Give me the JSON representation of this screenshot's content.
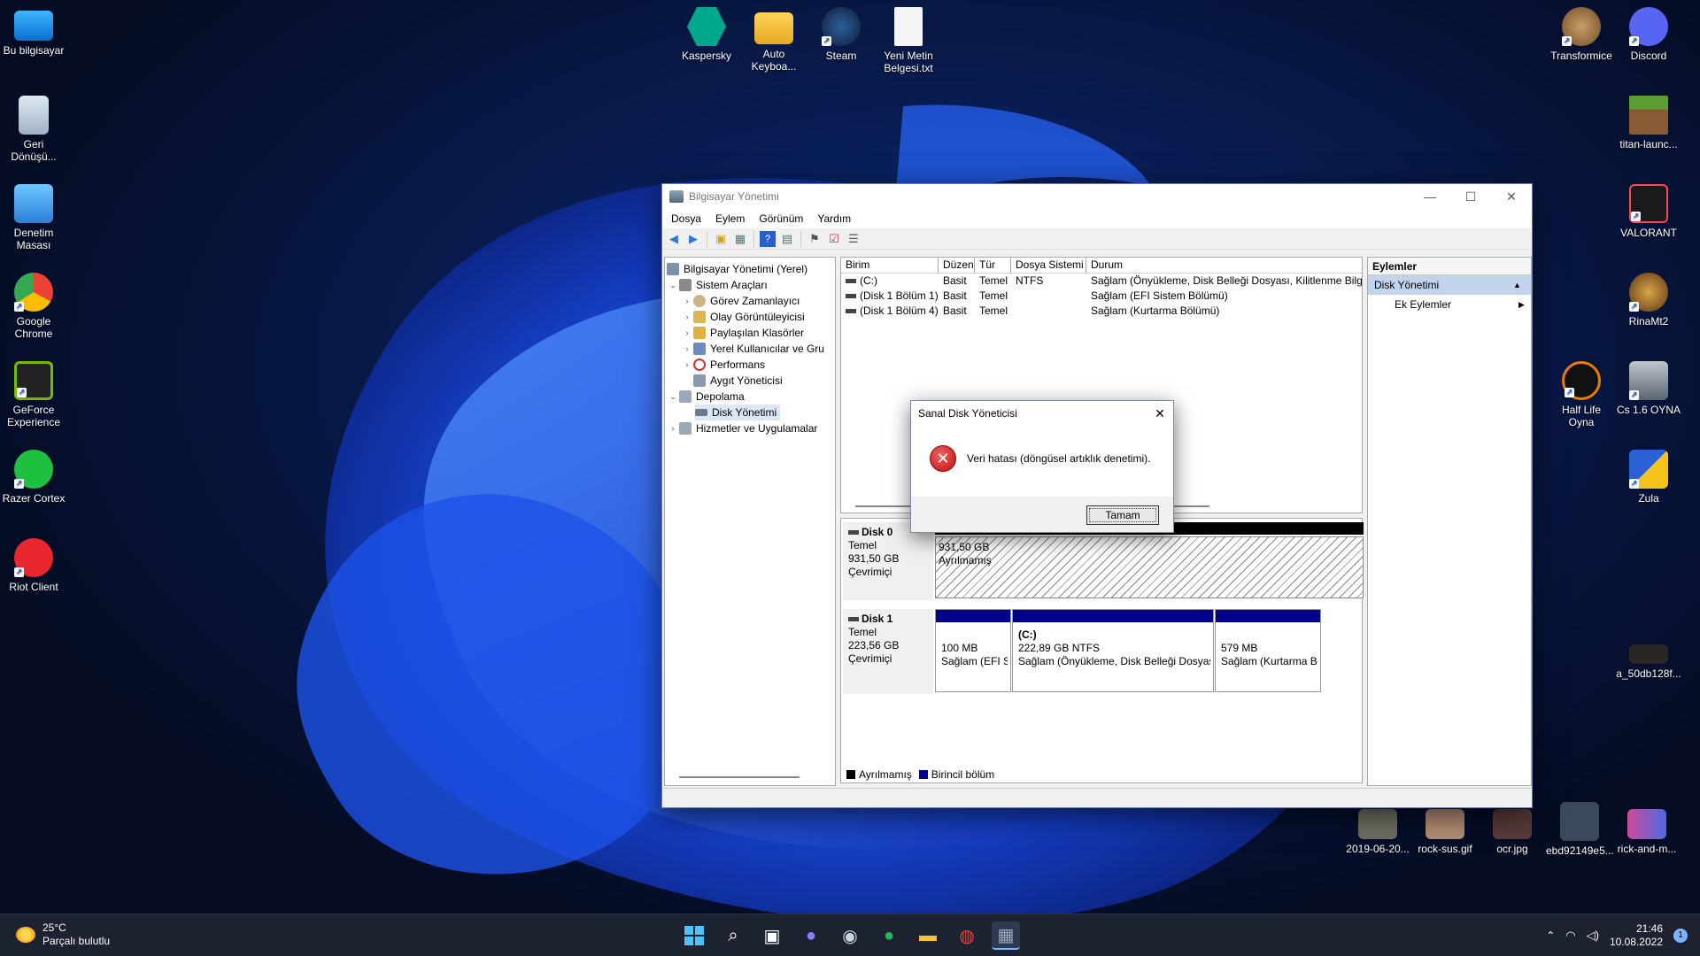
{
  "desktop": {
    "left_icons": [
      {
        "label": "Bu bilgisayar",
        "icon": "computer-icon"
      },
      {
        "label": "Geri Dönüşü...",
        "icon": "recycle-bin-icon"
      },
      {
        "label": "Denetim Masası",
        "icon": "control-panel-icon"
      },
      {
        "label": "Google Chrome",
        "icon": "chrome-icon"
      },
      {
        "label": "GeForce Experience",
        "icon": "geforce-icon"
      },
      {
        "label": "Razer Cortex",
        "icon": "razer-icon"
      },
      {
        "label": "Riot Client",
        "icon": "riot-icon"
      }
    ],
    "top_icons": [
      {
        "label": "Kaspersky",
        "icon": "kaspersky-icon"
      },
      {
        "label": "Auto Keyboa...",
        "icon": "folder-icon"
      },
      {
        "label": "Steam",
        "icon": "steam-icon"
      },
      {
        "label": "Yeni Metin Belgesi.txt",
        "icon": "text-file-icon"
      }
    ],
    "right_icons": [
      {
        "label": "Transformice",
        "icon": "transformice-icon"
      },
      {
        "label": "Discord",
        "icon": "discord-icon"
      },
      {
        "label": "titan-launc...",
        "icon": "minecraft-icon"
      },
      {
        "label": "VALORANT",
        "icon": "valorant-icon"
      },
      {
        "label": "RinaMt2",
        "icon": "rina-icon"
      },
      {
        "label": "Half Life Oyna",
        "icon": "half-life-icon"
      },
      {
        "label": "Cs 1.6 OYNA",
        "icon": "cs-icon"
      },
      {
        "label": "Zula",
        "icon": "zula-icon"
      },
      {
        "label": "a_50db128f...",
        "icon": "image-file-icon"
      }
    ],
    "bottom_icons": [
      {
        "label": "2019-06-20...",
        "icon": "image-file-icon"
      },
      {
        "label": "rock-sus.gif",
        "icon": "image-file-icon"
      },
      {
        "label": "ocr.jpg",
        "icon": "image-file-icon"
      },
      {
        "label": "ebd92149e5...",
        "icon": "image-file-icon"
      },
      {
        "label": "rick-and-m...",
        "icon": "image-file-icon"
      }
    ]
  },
  "window": {
    "title": "Bilgisayar Yönetimi",
    "menu": [
      "Dosya",
      "Eylem",
      "Görünüm",
      "Yardım"
    ],
    "tree": {
      "root": "Bilgisayar Yönetimi (Yerel)",
      "system_tools": "Sistem Araçları",
      "items": [
        "Görev Zamanlayıcı",
        "Olay Görüntüleyicisi",
        "Paylaşılan Klasörler",
        "Yerel Kullanıcılar ve Gru",
        "Performans",
        "Aygıt Yöneticisi"
      ],
      "storage": "Depolama",
      "disk_mgmt": "Disk Yönetimi",
      "services": "Hizmetler ve Uygulamalar"
    },
    "volumes": {
      "headers": [
        "Birim",
        "Düzen",
        "Tür",
        "Dosya Sistemi",
        "Durum"
      ],
      "rows": [
        [
          "(C:)",
          "Basit",
          "Temel",
          "NTFS",
          "Sağlam (Önyükleme, Disk Belleği Dosyası, Kilitlenme Bilgis"
        ],
        [
          "(Disk 1 Bölüm 1)",
          "Basit",
          "Temel",
          "",
          "Sağlam (EFI Sistem Bölümü)"
        ],
        [
          "(Disk 1 Bölüm 4)",
          "Basit",
          "Temel",
          "",
          "Sağlam (Kurtarma Bölümü)"
        ]
      ]
    },
    "disks": [
      {
        "name": "Disk 0",
        "type": "Temel",
        "size": "931,50 GB",
        "status": "Çevrimiçi",
        "partitions": [
          {
            "line1": "931,50 GB",
            "line2": "Ayrılmamış"
          }
        ]
      },
      {
        "name": "Disk 1",
        "type": "Temel",
        "size": "223,56 GB",
        "status": "Çevrimiçi",
        "partitions": [
          {
            "line0": "",
            "line1": "100 MB",
            "line2": "Sağlam (EFI S"
          },
          {
            "line0": "(C:)",
            "line1": "222,89 GB NTFS",
            "line2": "Sağlam (Önyükleme, Disk Belleği Dosyası"
          },
          {
            "line0": "",
            "line1": "579 MB",
            "line2": "Sağlam (Kurtarma B"
          }
        ]
      }
    ],
    "legend": {
      "unallocated": "Ayrılmamış",
      "primary": "Birincil bölüm"
    },
    "actions": {
      "header": "Eylemler",
      "section": "Disk Yönetimi",
      "item": "Ek Eylemler"
    }
  },
  "dialog": {
    "title": "Sanal Disk Yöneticisi",
    "message": "Veri hatası (döngüsel artıklık denetimi).",
    "ok": "Tamam"
  },
  "taskbar": {
    "temperature": "25°C",
    "weather": "Parçalı bulutlu",
    "time": "21:46",
    "date": "10.08.2022",
    "notification_count": "1"
  }
}
